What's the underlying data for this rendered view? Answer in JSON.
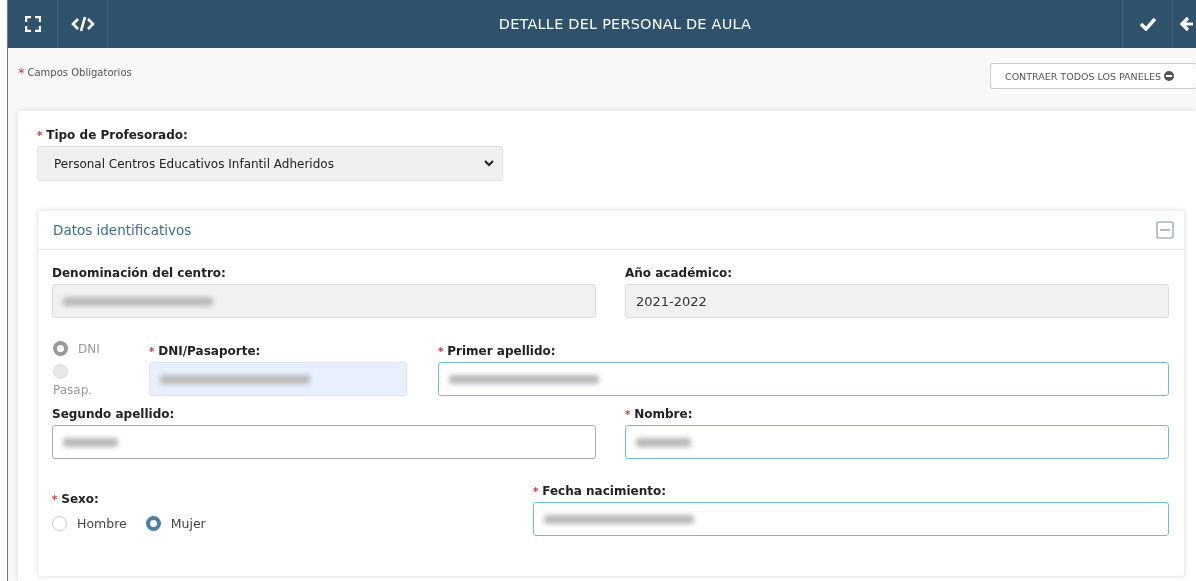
{
  "required_mark": "*",
  "header": {
    "title": "DETALLE DEL PERSONAL DE AULA",
    "left_buttons": [
      {
        "kind": "expand"
      },
      {
        "kind": "code"
      }
    ],
    "right_buttons": [
      {
        "kind": "check"
      },
      {
        "kind": "back"
      }
    ]
  },
  "required_note": "Campos Obligatorios",
  "collapse_button": {
    "label": "CONTRAER TODOS LOS PANELES"
  },
  "teacher_type": {
    "label": "Tipo de Profesorado:",
    "required": true,
    "value": "Personal Centros Educativos Infantil Adheridos"
  },
  "panel": {
    "title": "Datos identificativos",
    "expanded": true,
    "centre": {
      "label": "Denominación del centro:",
      "required": false,
      "kind": "readonly",
      "blurred": true
    },
    "year": {
      "label": "Año académico:",
      "required": false,
      "kind": "readonly",
      "value": "2021-2022"
    },
    "doc_type": {
      "disabled": true,
      "options": [
        {
          "label": "DNI",
          "selected": true
        },
        {
          "label": "Pasap.",
          "selected": false
        }
      ]
    },
    "doc_number": {
      "label": "DNI/Pasaporte:",
      "required": true,
      "kind": "autofill",
      "blurred": true
    },
    "surname1": {
      "label": "Primer apellido:",
      "required": true,
      "kind": "valid",
      "blurred": true
    },
    "surname2": {
      "label": "Segundo apellido:",
      "required": false,
      "kind": "plain",
      "blurred": true
    },
    "name": {
      "label": "Nombre:",
      "required": true,
      "kind": "valid",
      "blurred": true
    },
    "sex": {
      "label": "Sexo:",
      "required": true,
      "disabled": false,
      "options": [
        {
          "label": "Hombre",
          "selected": false
        },
        {
          "label": "Mujer",
          "selected": true
        }
      ]
    },
    "birth_date": {
      "label": "Fecha nacimiento:",
      "required": true,
      "kind": "valid",
      "blurred": true
    }
  }
}
